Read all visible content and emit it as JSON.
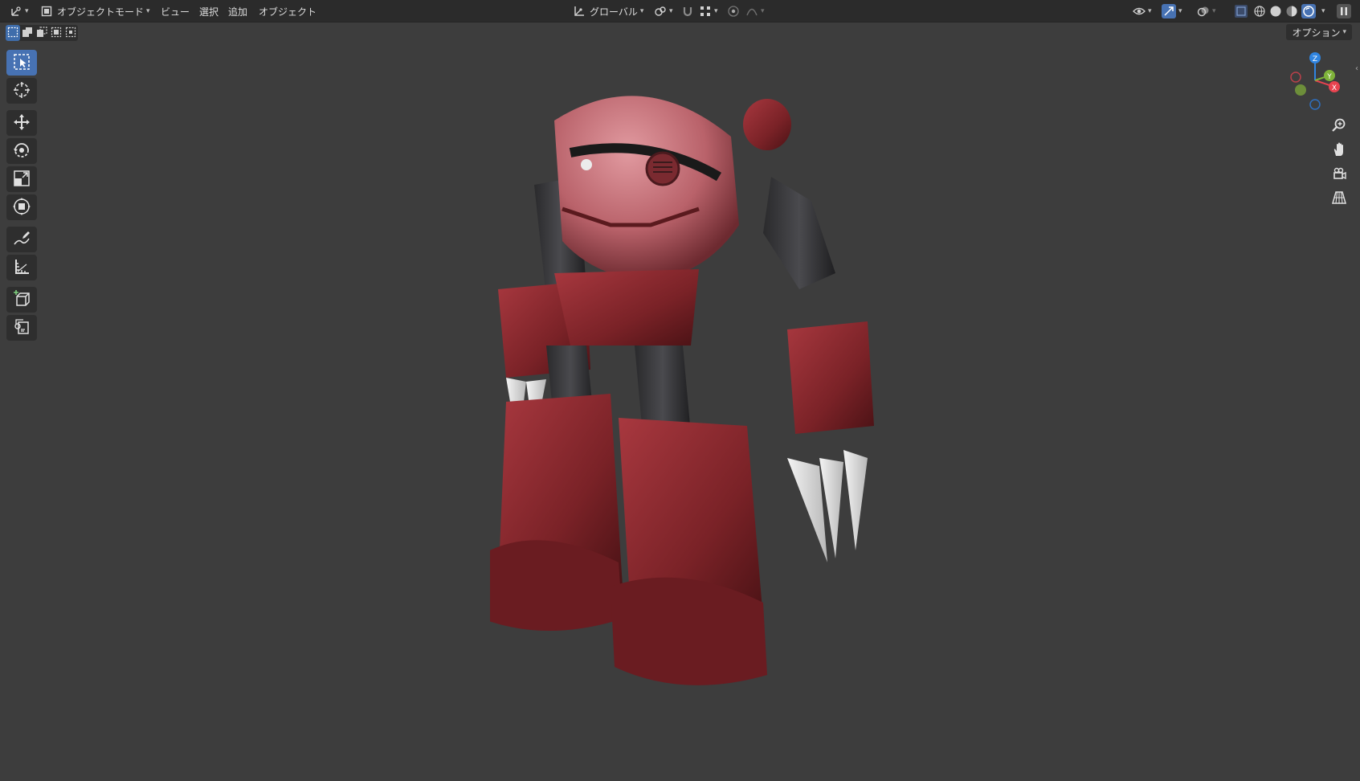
{
  "header": {
    "mode_label": "オブジェクトモード",
    "menus": [
      "ビュー",
      "選択",
      "追加",
      "オブジェクト"
    ],
    "transform_orientation": "グローバル",
    "options_label": "オプション"
  },
  "gizmo": {
    "x": "X",
    "y": "Y",
    "z": "Z"
  },
  "tools": [
    {
      "name": "select-box-tool",
      "icon": "select-box-icon",
      "active": true
    },
    {
      "name": "cursor-tool",
      "icon": "cursor-icon"
    },
    {
      "name": "move-tool",
      "icon": "move-icon"
    },
    {
      "name": "rotate-tool",
      "icon": "rotate-icon"
    },
    {
      "name": "scale-tool",
      "icon": "scale-icon"
    },
    {
      "name": "transform-tool",
      "icon": "transform-icon"
    },
    {
      "name": "annotate-tool",
      "icon": "annotate-icon"
    },
    {
      "name": "measure-tool",
      "icon": "measure-icon"
    },
    {
      "name": "add-cube-tool",
      "icon": "add-cube-icon"
    },
    {
      "name": "object-add-tool",
      "icon": "object-add-icon"
    }
  ],
  "colors": {
    "accent": "#4772b3",
    "background": "#3d3d3d",
    "header": "#2b2b2b",
    "axis_x": "#e8434f",
    "axis_y": "#7fb33a",
    "axis_z": "#2f84e0"
  }
}
